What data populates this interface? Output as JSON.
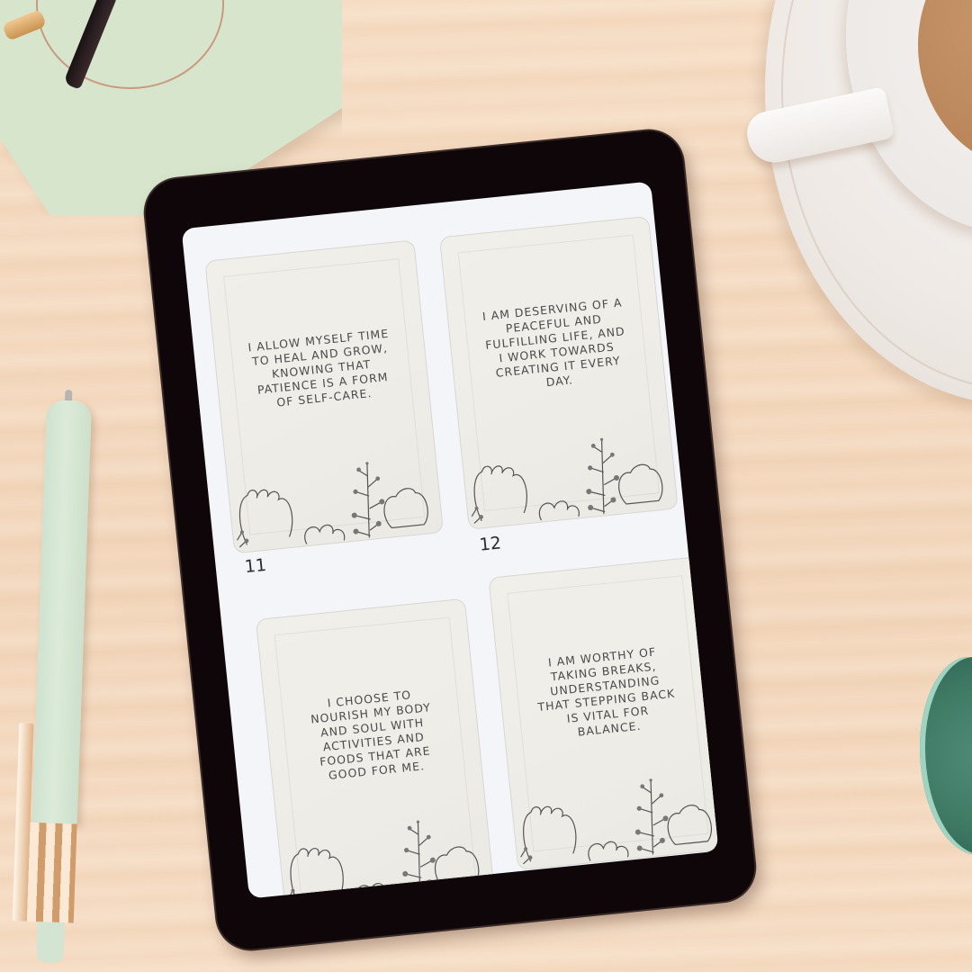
{
  "scene": {
    "description": "Flat-lay desk scene with tablet displaying affirmation cards",
    "background_color": "#f5dcc3",
    "objects": [
      "glasses-pouch",
      "glasses",
      "coffee-cup",
      "saucer",
      "pen",
      "plant"
    ]
  },
  "tablet": {
    "screen_background": "#f4f5f8",
    "cards": [
      {
        "number": "11",
        "text": "I allow myself time to heal and grow, knowing that patience is a form of self-care.",
        "show_label": true
      },
      {
        "number": "12",
        "text": "I am deserving of a peaceful and fulfilling life, and I work towards creating it every day.",
        "show_label": true
      },
      {
        "number": "",
        "text": "I choose to nourish my body and soul with activities and foods that are good for me.",
        "show_label": false
      },
      {
        "number": "",
        "text": "I am worthy of taking breaks, understanding that stepping back is vital for balance.",
        "show_label": false
      }
    ]
  },
  "colors": {
    "card_bg": "#efede7",
    "card_text": "#4b4b4b",
    "tablet_bezel": "#0e0608",
    "line_art": "#555555"
  }
}
